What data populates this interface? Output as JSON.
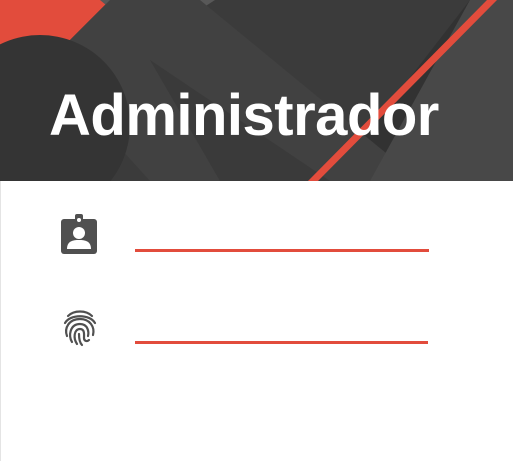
{
  "login": {
    "title": "Administrador",
    "username_field": {
      "value": "",
      "placeholder": ""
    },
    "password_field": {
      "value": "",
      "placeholder": ""
    }
  },
  "icons": {
    "username": "contact-badge-icon",
    "password": "fingerprint-icon"
  },
  "colors": {
    "accent": "#e24c3c",
    "header_dark": "#3a3a3a",
    "title_text": "#ffffff",
    "icon": "#505050"
  }
}
